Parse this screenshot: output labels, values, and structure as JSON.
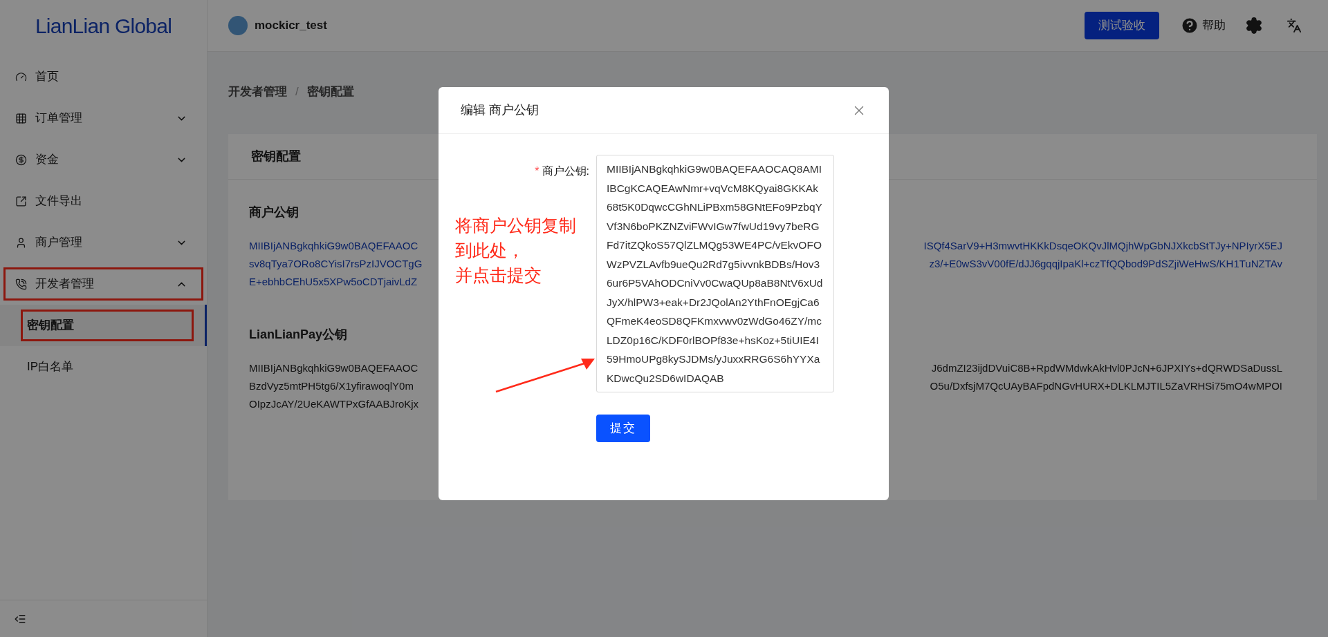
{
  "header": {
    "logo": "LianLian Global",
    "account": "mockicr_test",
    "test_button": "测试验收",
    "help": "帮助"
  },
  "sidebar": {
    "items": [
      {
        "label": "首页",
        "kind": "link",
        "annotated": false
      },
      {
        "label": "订单管理",
        "kind": "group",
        "expanded": false,
        "annotated": false
      },
      {
        "label": "资金",
        "kind": "group",
        "expanded": false,
        "annotated": false
      },
      {
        "label": "文件导出",
        "kind": "link",
        "annotated": false
      },
      {
        "label": "商户管理",
        "kind": "group",
        "expanded": false,
        "annotated": false
      },
      {
        "label": "开发者管理",
        "kind": "group",
        "expanded": true,
        "annotated": true,
        "children": [
          {
            "label": "密钥配置",
            "selected": true,
            "annotated": true
          },
          {
            "label": "IP白名单",
            "selected": false,
            "annotated": false
          }
        ]
      }
    ]
  },
  "breadcrumb": {
    "items": [
      "开发者管理",
      "密钥配置"
    ],
    "separator": "/"
  },
  "card": {
    "title": "密钥配置",
    "sections": [
      {
        "title": "商户公钥",
        "kind": "link",
        "lines": [
          {
            "left": "MIIBIjANBgkqhkiG9w0BAQEFAAOC",
            "right": "ISQf4SarV9+H3mwvtHKKkDsqeOKQvJlMQjhWpGbNJXkcbStTJy+NPIyrX5EJ"
          },
          {
            "left": "sv8qTya7ORo8CYisI7rsPzIJVOCTgG",
            "right": "z3/+E0wS3vV00fE/dJJ6gqqjIpaKl+czTfQQbod9PdSZjiWeHwS/KH1TuNZTAv"
          },
          {
            "left": "E+ebhbCEhU5x5XPw5oCDTjaivLdZ"
          }
        ]
      },
      {
        "title": "LianLianPay公钥",
        "kind": "text",
        "lines": [
          {
            "left": "MIIBIjANBgkqhkiG9w0BAQEFAAOC",
            "right": "J6dmZI23ijdDVuiC8B+RpdWMdwkAkHvl0PJcN+6JPXIYs+dQRWDSaDussL"
          },
          {
            "left": "BzdVyz5mtPH5tg6/X1yfirawoqlY0m",
            "right": "O5u/DxfsjM7QcUAyBAFpdNGvHURX+DLKLMJTIL5ZaVRHSi75mO4wMPOI"
          },
          {
            "left": "OIpzJcAY/2UeKAWTPxGfAABJroKjx"
          }
        ]
      }
    ]
  },
  "modal": {
    "title": "编辑 商户公钥",
    "field": {
      "label": "商户公钥:",
      "required": true,
      "required_mark": "*",
      "value": "MIIBIjANBgkqhkiG9w0BAQEFAAOCAQ8AMIIBCgKCAQEAwNmr+vqVcM8KQyai8GKKAk68t5K0DqwcCGhNLiPBxm58GNtEFo9PzbqYVf3N6boPKZNZviFWvIGw7fwUd19vy7beRGFd7itZQkoS57QlZLMQg53WE4PC/vEkvOFOWzPVZLAvfb9ueQu2Rd7g5ivvnkBDBs/Hov36ur6P5VAhODCniVv0CwaQUp8aB8NtV6xUdJyX/hlPW3+eak+Dr2JQolAn2YthFnOEgjCa6QFmeK4eoSD8QFKmxvwv0zWdGo46ZY/mcLDZ0p16C/KDF0rlBOPf83e+hsKoz+5tiUIE4I59HmoUPg8kySJDMs/yJuxxRRG6S6hYYXaKDwcQu2SD6wIDAQAB"
    },
    "submit": "提交"
  },
  "annotation": {
    "lines": [
      "将商户公钥复制",
      "到此处，",
      "并点击提交"
    ]
  }
}
